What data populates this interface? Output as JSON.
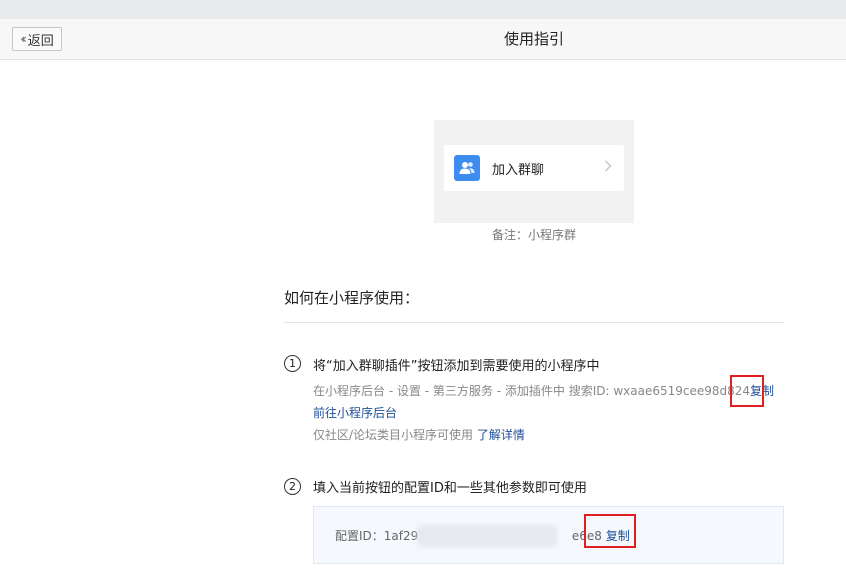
{
  "header": {
    "back_label": "返回",
    "title": "使用指引"
  },
  "preview": {
    "plugin_label": "加入群聊",
    "remark": "备注：小程序群"
  },
  "section": {
    "title": "如何在小程序使用："
  },
  "step1": {
    "number": "1",
    "title": "将“加入群聊插件”按钮添加到需要使用的小程序中",
    "path_text": "在小程序后台 - 设置 - 第三方服务 - 添加插件中 搜索ID: wxaae6519cee98d824",
    "copy_label": "复制",
    "goto_link": "前往小程序后台",
    "note_text": "仅社区/论坛类目小程序可使用",
    "details_link": "了解详情"
  },
  "step2": {
    "number": "2",
    "title": "填入当前按钮的配置ID和一些其他参数即可使用",
    "config_prefix": "配置ID：1af297",
    "config_suffix": "e6e8",
    "copy_label": "复制"
  },
  "colors": {
    "accent": "#3e8cf0",
    "link": "#1f4e99",
    "highlight": "#e02020"
  },
  "icons": {
    "back": "double-chevron-left-icon",
    "plugin": "users-icon",
    "chevron": "chevron-right-icon"
  }
}
